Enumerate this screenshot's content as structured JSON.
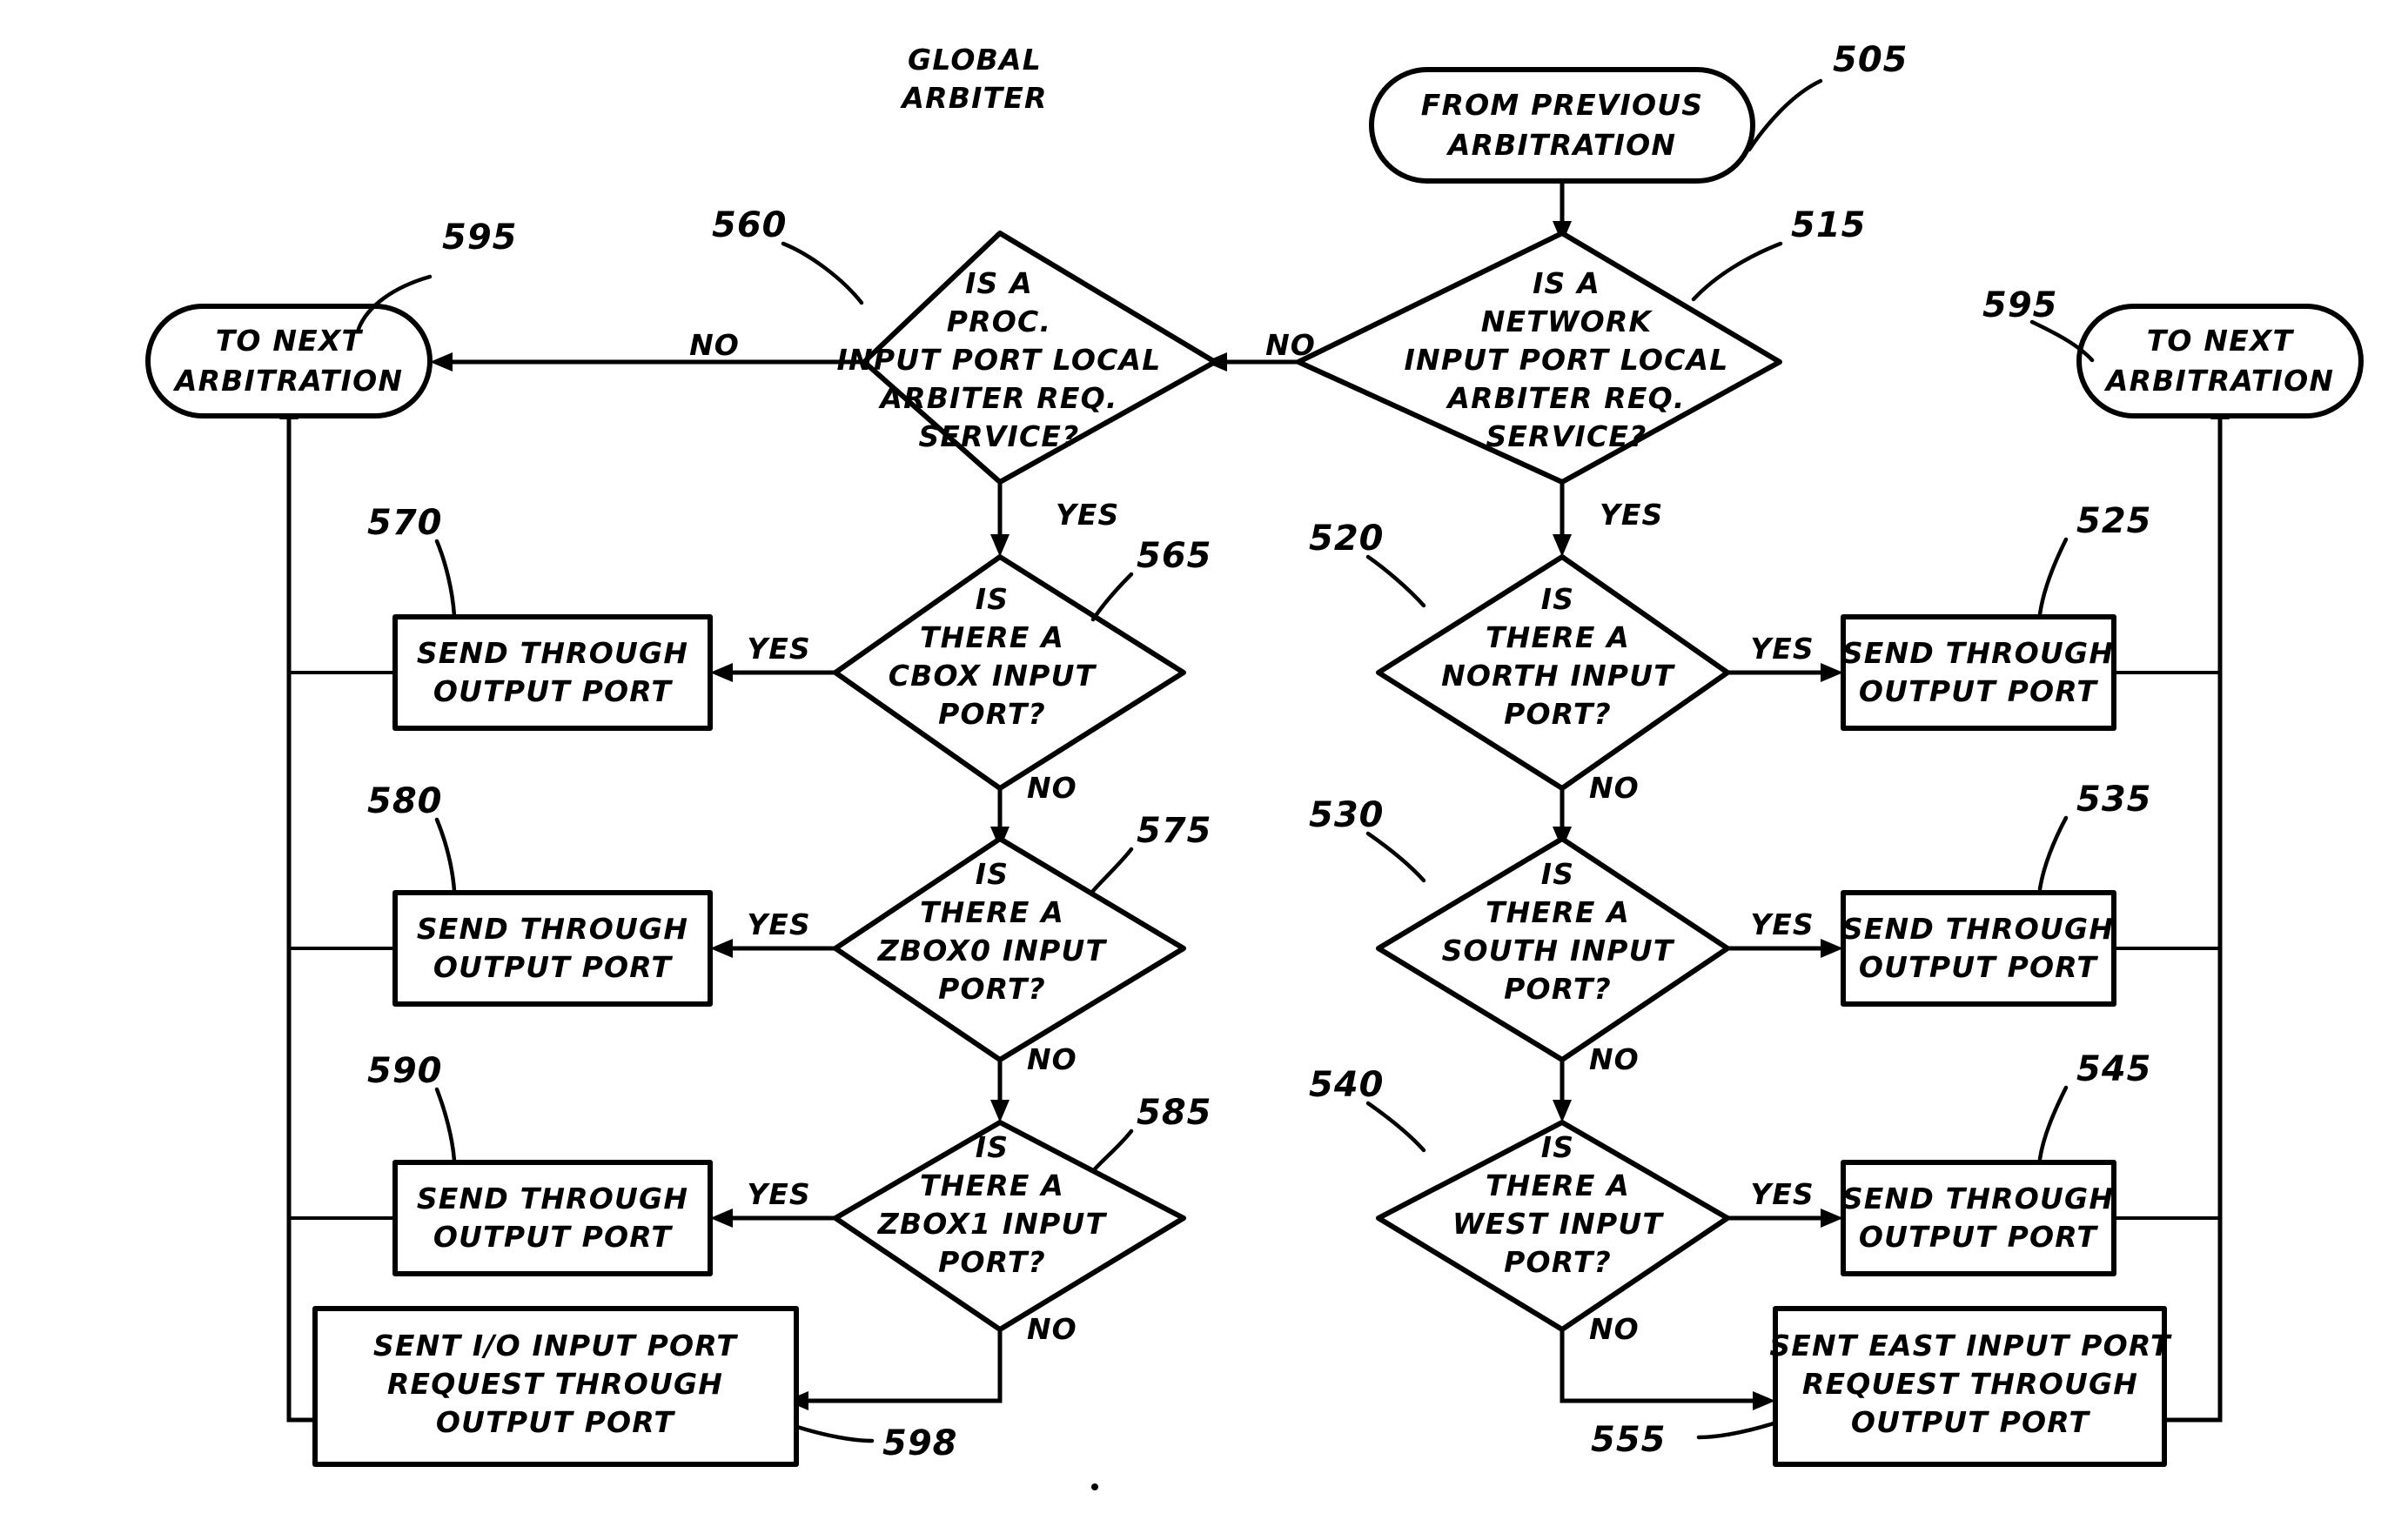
{
  "figure": {
    "caption": "GLOBAL ARBITER",
    "background_color": "#ffffff",
    "line_color": "#000000"
  },
  "terminals": {
    "from_previous": {
      "line1": "FROM PREVIOUS",
      "line2": "ARBITRATION",
      "ref": "505"
    },
    "to_next_left": {
      "line1": "TO NEXT",
      "line2": "ARBITRATION",
      "ref": "595"
    },
    "to_next_right": {
      "line1": "TO NEXT",
      "line2": "ARBITRATION",
      "ref": "595"
    }
  },
  "decisions": {
    "proc_local_arbiter": {
      "ref": "560",
      "lines": [
        "IS A",
        "PROC.",
        "INPUT PORT LOCAL",
        "ARBITER REQ.",
        "SERVICE?"
      ],
      "no_label": "NO",
      "yes_label": "YES"
    },
    "network_local_arbiter": {
      "ref": "515",
      "lines": [
        "IS A",
        "NETWORK",
        "INPUT PORT LOCAL",
        "ARBITER REQ.",
        "SERVICE?"
      ],
      "no_label": "NO",
      "yes_label": "YES"
    },
    "cbox": {
      "ref": "565",
      "lines": [
        "IS",
        "THERE A",
        "CBOX INPUT",
        "PORT?"
      ],
      "yes_label": "YES",
      "no_label": "NO"
    },
    "zbox0": {
      "ref": "575",
      "lines": [
        "IS",
        "THERE A",
        "ZBOX0 INPUT",
        "PORT?"
      ],
      "yes_label": "YES",
      "no_label": "NO"
    },
    "zbox1": {
      "ref": "585",
      "lines": [
        "IS",
        "THERE A",
        "ZBOX1 INPUT",
        "PORT?"
      ],
      "yes_label": "YES",
      "no_label": "NO"
    },
    "north": {
      "ref": "520",
      "lines": [
        "IS",
        "THERE A",
        "NORTH INPUT",
        "PORT?"
      ],
      "yes_label": "YES",
      "no_label": "NO"
    },
    "south": {
      "ref": "530",
      "lines": [
        "IS",
        "THERE A",
        "SOUTH INPUT",
        "PORT?"
      ],
      "yes_label": "YES",
      "no_label": "NO"
    },
    "west": {
      "ref": "540",
      "lines": [
        "IS",
        "THERE A",
        "WEST INPUT",
        "PORT?"
      ],
      "yes_label": "YES",
      "no_label": "NO"
    }
  },
  "processes": {
    "send_cbox": {
      "ref": "570",
      "lines": [
        "SEND THROUGH",
        "OUTPUT PORT"
      ]
    },
    "send_zbox0": {
      "ref": "580",
      "lines": [
        "SEND THROUGH",
        "OUTPUT PORT"
      ]
    },
    "send_zbox1": {
      "ref": "590",
      "lines": [
        "SEND THROUGH",
        "OUTPUT PORT"
      ]
    },
    "send_north": {
      "ref": "525",
      "lines": [
        "SEND THROUGH",
        "OUTPUT PORT"
      ]
    },
    "send_south": {
      "ref": "535",
      "lines": [
        "SEND THROUGH",
        "OUTPUT PORT"
      ]
    },
    "send_west": {
      "ref": "545",
      "lines": [
        "SEND THROUGH",
        "OUTPUT PORT"
      ]
    },
    "sent_io": {
      "ref": "598",
      "lines": [
        "SENT I/O INPUT PORT",
        "REQUEST THROUGH",
        "OUTPUT PORT"
      ]
    },
    "sent_east": {
      "ref": "555",
      "lines": [
        "SENT EAST INPUT PORT",
        "REQUEST THROUGH",
        "OUTPUT PORT"
      ]
    }
  }
}
